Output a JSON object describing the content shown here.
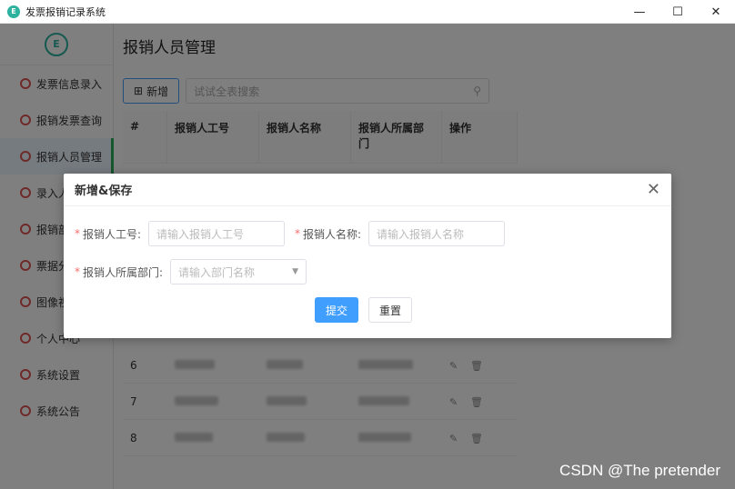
{
  "window": {
    "title": "发票报销记录系统",
    "icon": "app-logo-icon",
    "min": "—",
    "max": "☐",
    "close": "✕"
  },
  "sidebar": {
    "items": [
      {
        "label": "发票信息录入"
      },
      {
        "label": "报销发票查询"
      },
      {
        "label": "报销人员管理",
        "active": true
      },
      {
        "label": "录入人"
      },
      {
        "label": "报销部"
      },
      {
        "label": "票据分"
      },
      {
        "label": "图像视"
      },
      {
        "label": "个人中心"
      },
      {
        "label": "系统设置"
      },
      {
        "label": "系统公告"
      }
    ]
  },
  "main": {
    "title": "报销人员管理",
    "add_label": "新增",
    "search_placeholder": "试试全表搜索",
    "table": {
      "headers": [
        "#",
        "报销人工号",
        "报销人名称",
        "报销人所属部门",
        "操作"
      ],
      "rows": [
        {
          "index": "6"
        },
        {
          "index": "7"
        },
        {
          "index": "8"
        }
      ]
    }
  },
  "dialog": {
    "title": "新增&保存",
    "close": "✕",
    "fields": {
      "id_label": "报销人工号:",
      "id_placeholder": "请输入报销人工号",
      "name_label": "报销人名称:",
      "name_placeholder": "请输入报销人名称",
      "dept_label": "报销人所属部门:",
      "dept_placeholder": "请输入部门名称"
    },
    "submit_label": "提交",
    "reset_label": "重置"
  },
  "watermark": "CSDN @The  pretender",
  "colors": {
    "primary": "#409eff",
    "accent": "#2fae5a",
    "required": "#f56c6c"
  }
}
